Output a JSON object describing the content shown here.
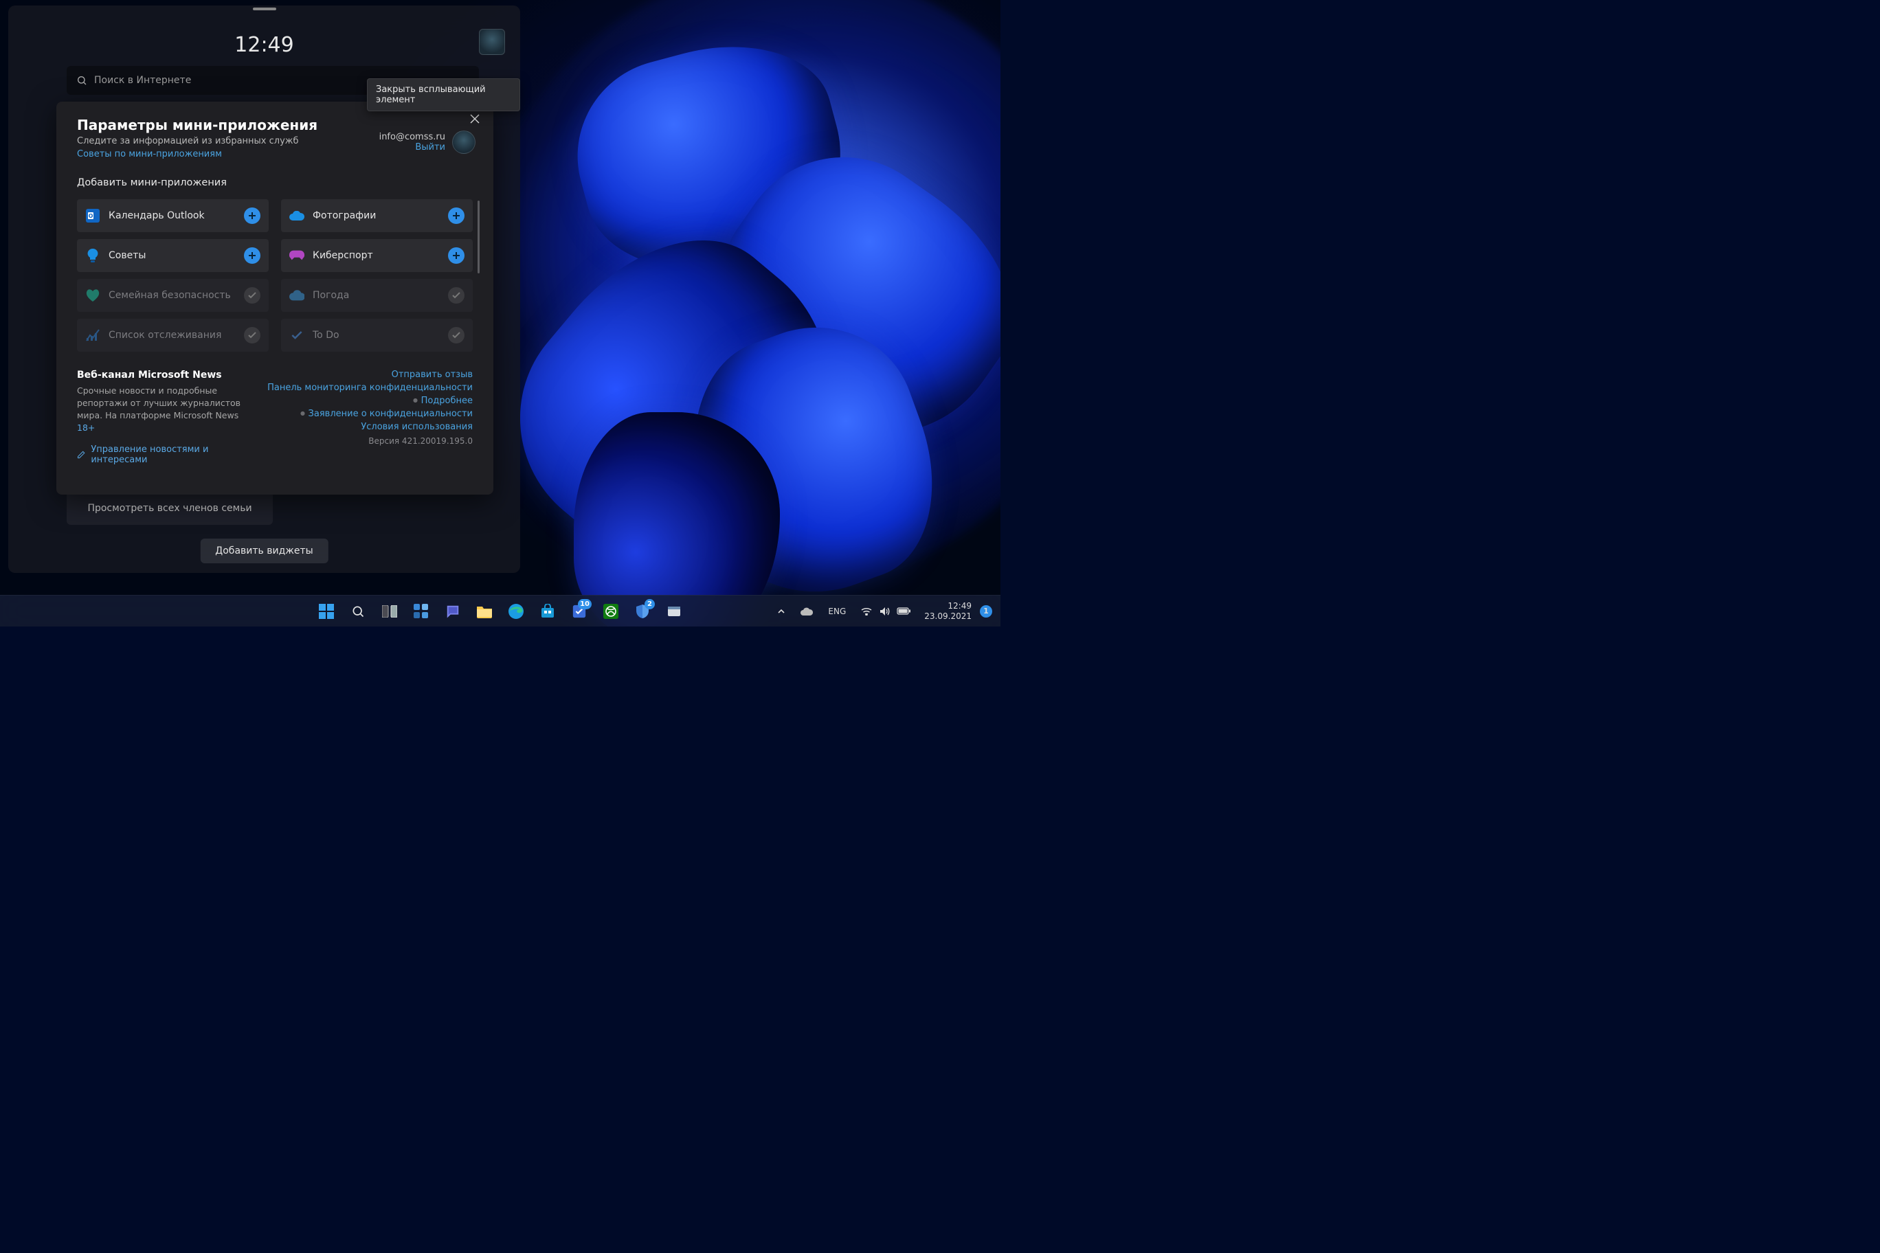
{
  "widgets_panel": {
    "clock": "12:49",
    "search_placeholder": "Поиск в Интернете",
    "see_family": "Просмотреть всех членов семьи",
    "add_widgets_button": "Добавить виджеты"
  },
  "tooltip": "Закрыть всплывающий элемент",
  "settings": {
    "title": "Параметры мини-приложения",
    "subtitle": "Следите за информацией из избранных служб",
    "tips_link": "Советы по мини-приложениям",
    "account_email": "info@comss.ru",
    "sign_out": "Выйти",
    "add_section": "Добавить мини-приложения",
    "widgets": [
      {
        "label": "Календарь Outlook",
        "icon": "outlook",
        "action": "add"
      },
      {
        "label": "Фотографии",
        "icon": "onedrive",
        "action": "add"
      },
      {
        "label": "Советы",
        "icon": "tips",
        "action": "add"
      },
      {
        "label": "Киберспорт",
        "icon": "esports",
        "action": "add"
      },
      {
        "label": "Семейная безопасность",
        "icon": "family",
        "action": "added"
      },
      {
        "label": "Погода",
        "icon": "weather",
        "action": "added"
      },
      {
        "label": "Список отслеживания",
        "icon": "stocks",
        "action": "added"
      },
      {
        "label": "To Do",
        "icon": "todo",
        "action": "added"
      }
    ],
    "news": {
      "title": "Веб-канал Microsoft News",
      "description": "Срочные новости и подробные репортажи от лучших журналистов мира. На платформе Microsoft News",
      "age": "18+",
      "manage": "Управление новостями и интересами"
    },
    "links": {
      "feedback": "Отправить отзыв",
      "privacy_dashboard": "Панель мониторинга конфиденциальности",
      "learn_more": "Подробнее",
      "privacy_statement": "Заявление о конфиденциальности",
      "terms": "Условия использования",
      "version": "Версия 421.20019.195.0"
    }
  },
  "taskbar": {
    "todo_badge": "10",
    "security_badge": "2",
    "language": "ENG",
    "clock_time": "12:49",
    "clock_date": "23.09.2021",
    "notif_count": "1"
  }
}
